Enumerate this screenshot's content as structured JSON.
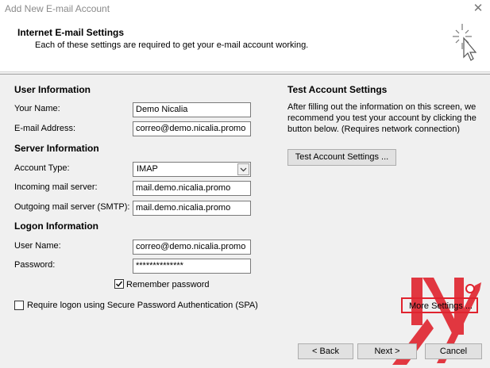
{
  "window": {
    "title": "Add New E-mail Account",
    "close_glyph": "✕"
  },
  "header": {
    "title": "Internet E-mail Settings",
    "subtitle": "Each of these settings are required to get your e-mail account working."
  },
  "user_info": {
    "heading": "User Information",
    "name_label": "Your Name:",
    "name_value": "Demo Nicalia",
    "email_label": "E-mail Address:",
    "email_value": "correo@demo.nicalia.promo"
  },
  "server_info": {
    "heading": "Server Information",
    "account_type_label": "Account Type:",
    "account_type_value": "IMAP",
    "incoming_label": "Incoming mail server:",
    "incoming_value": "mail.demo.nicalia.promo",
    "outgoing_label": "Outgoing mail server (SMTP):",
    "outgoing_value": "mail.demo.nicalia.promo"
  },
  "logon_info": {
    "heading": "Logon Information",
    "username_label": "User Name:",
    "username_value": "correo@demo.nicalia.promo",
    "password_label": "Password:",
    "password_value": "**************",
    "remember_label": "Remember password",
    "remember_checked": true,
    "spa_label": "Require logon using Secure Password Authentication (SPA)",
    "spa_checked": false
  },
  "test_settings": {
    "heading": "Test Account Settings",
    "description": "After filling out the information on this screen, we recommend you test your account by clicking the button below. (Requires network connection)",
    "button_label": "Test Account Settings ..."
  },
  "more_settings_label": "More Settings ...",
  "footer": {
    "back_label": "< Back",
    "next_label": "Next >",
    "cancel_label": "Cancel"
  },
  "colors": {
    "highlight_box": "#e0232e",
    "watermark": "#e0232e"
  }
}
